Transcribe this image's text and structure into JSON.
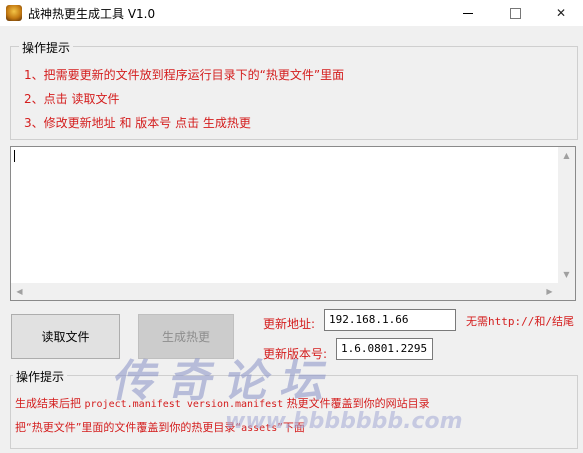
{
  "window": {
    "title": "战神热更生成工具 V1.0",
    "controls": {
      "minimize": "—",
      "maximize": "□",
      "close": "✕"
    }
  },
  "instructions": {
    "heading": "操作提示",
    "steps": [
      "1、把需要更新的文件放到程序运行目录下的“热更文件”里面",
      "2、点击 读取文件",
      "3、修改更新地址 和 版本号  点击 生成热更"
    ]
  },
  "log_area": {
    "value": ""
  },
  "actions": {
    "read_button": "读取文件",
    "generate_button": "生成热更"
  },
  "update_url": {
    "label": "更新地址:",
    "value": "192.168.1.66",
    "hint": "无需http://和/结尾"
  },
  "version": {
    "label": "更新版本号:",
    "value": "1.6.0801.2295"
  },
  "notes": {
    "heading": "操作提示",
    "line1_a": "生成结束后把 ",
    "line1_b": "project.manifest version.manifest",
    "line1_c": " 热更文件覆盖到你的网站目录",
    "line2_a": "把“热更文件”里面的文件覆盖到你的热更目录“",
    "line2_b": "assets",
    "line2_c": "”下面"
  },
  "watermark": {
    "text": "传奇论坛",
    "url": "www.bbbbbbb.com"
  },
  "colors": {
    "accent_red": "#d41d1d",
    "window_bg": "#f0f0f0",
    "disabled_text": "#8d8d8d"
  }
}
